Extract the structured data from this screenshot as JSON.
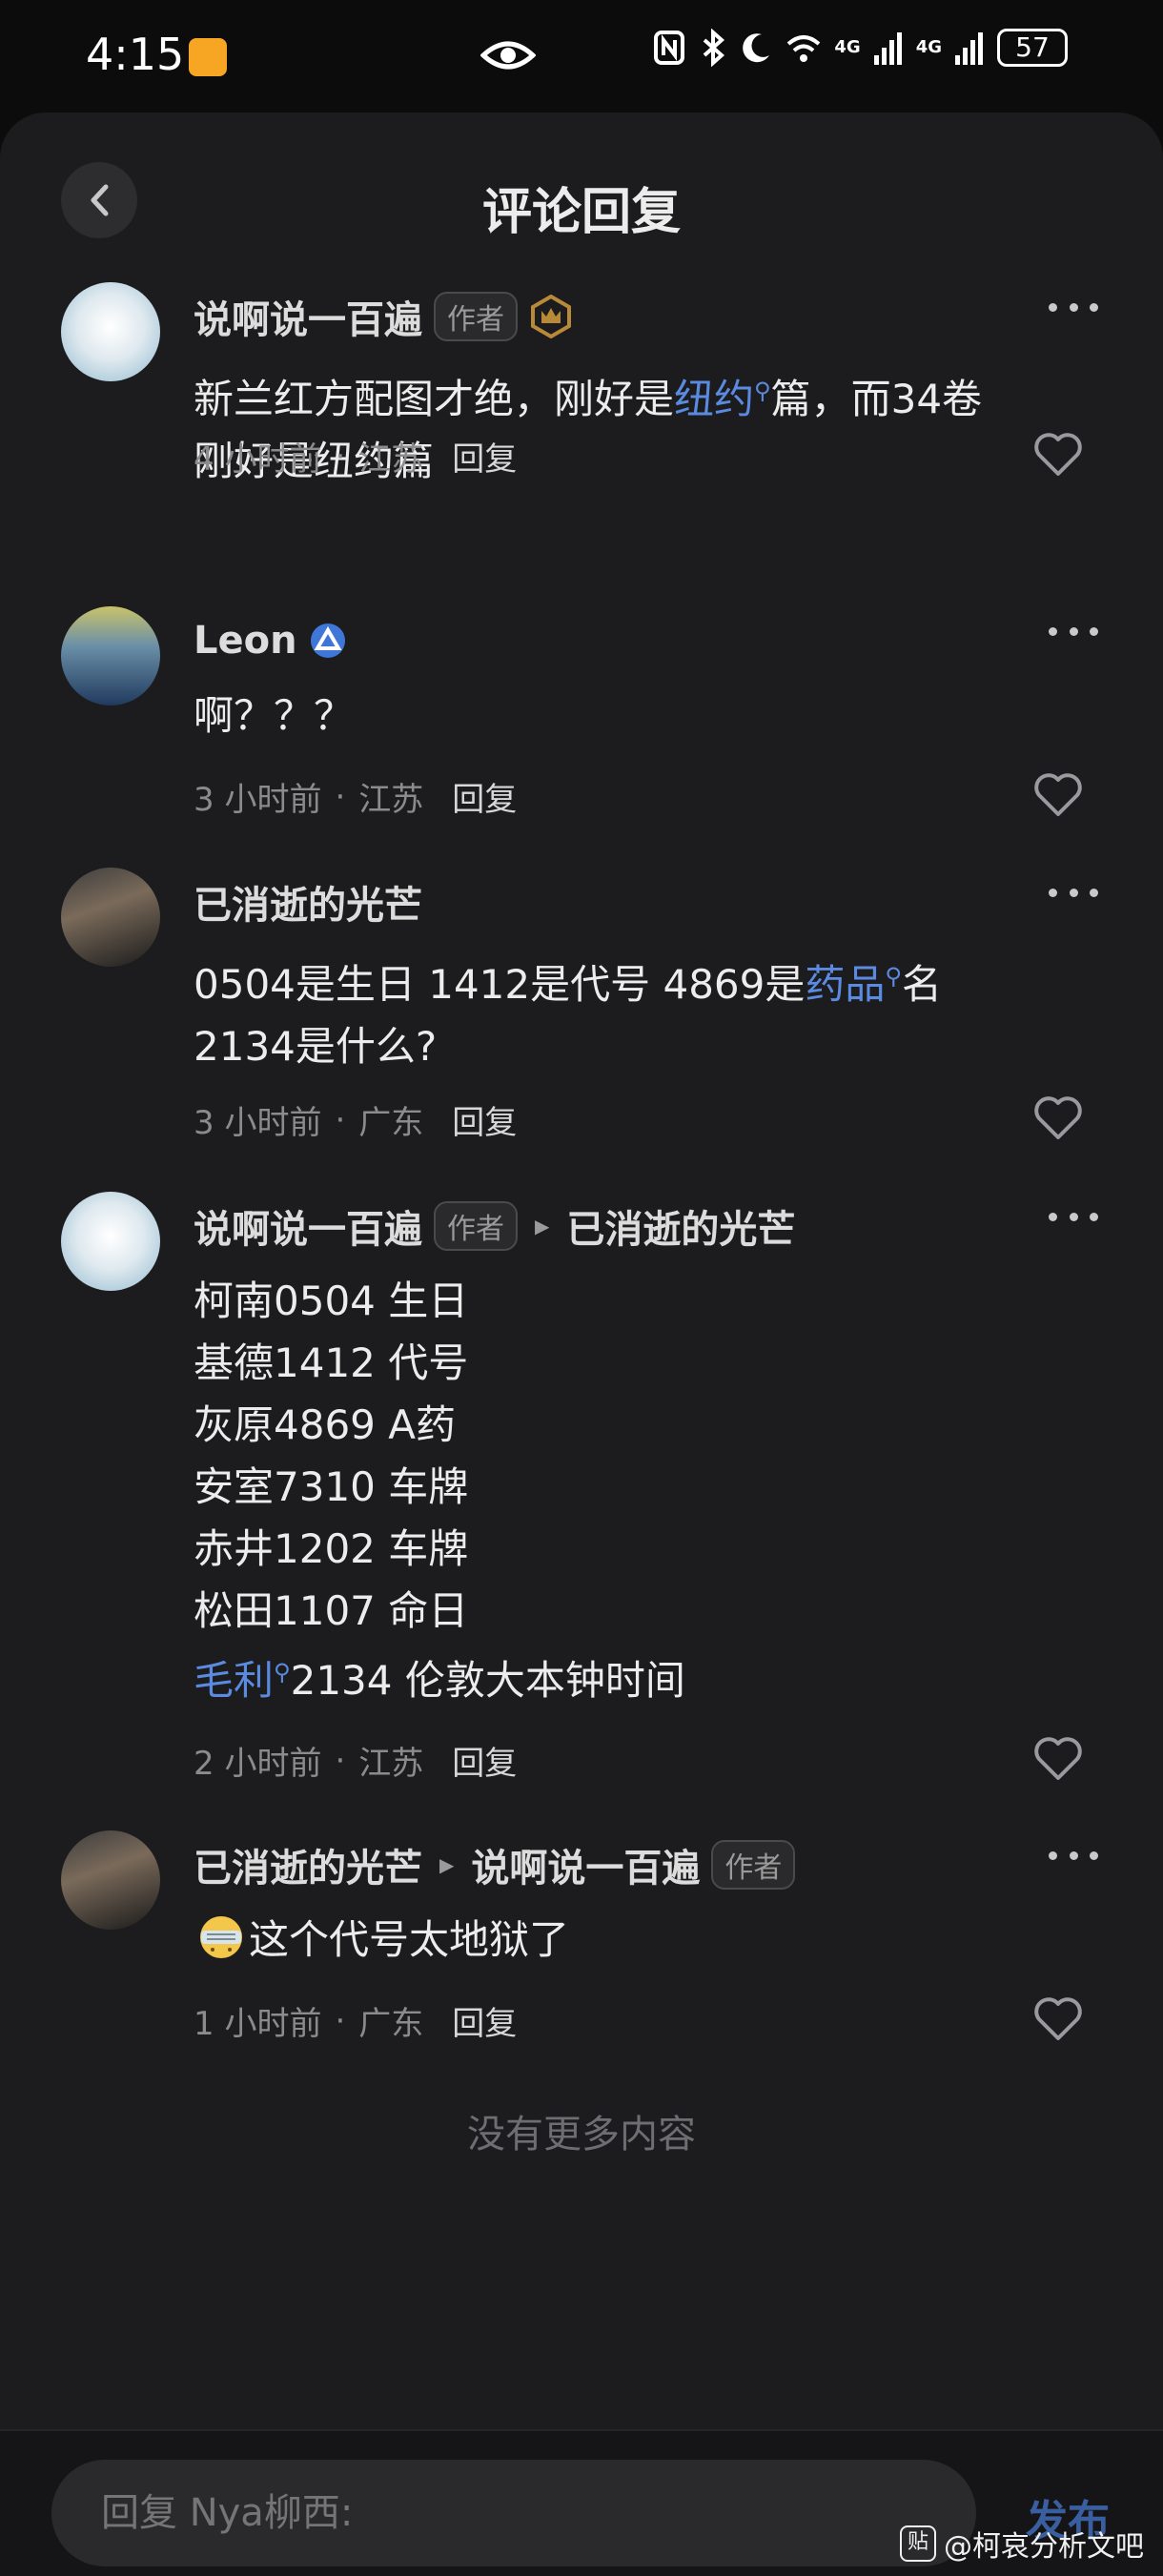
{
  "status_bar": {
    "time": "4:15",
    "battery": "57",
    "net1": "4G",
    "net2": "4G"
  },
  "header": {
    "title": "评论回复"
  },
  "comments": [
    {
      "name": "说啊说一百遍",
      "tag": "作者",
      "body_line1_pre": "新兰红方配图才绝，刚好是",
      "body_line1_link": "纽约",
      "body_line1_post": "篇，而34卷",
      "body_line2": "刚好是纽约篇",
      "time": "4 小时前",
      "location": "江苏",
      "reply": "回复"
    },
    {
      "name": "Leon",
      "body": "啊？？？",
      "time": "3 小时前",
      "location": "江苏",
      "reply": "回复"
    },
    {
      "name": "已消逝的光芒",
      "body_line1_pre": "0504是生日 1412是代号 4869是",
      "body_line1_link": "药品",
      "body_line1_post": "名",
      "body_line2": "2134是什么?",
      "time": "3 小时前",
      "location": "广东",
      "reply": "回复"
    },
    {
      "name": "说啊说一百遍",
      "tag": "作者",
      "reply_to": "已消逝的光芒",
      "lines": [
        "柯南0504 生日",
        "基德1412 代号",
        "灰原4869 A药",
        "安室7310 车牌",
        "赤井1202 车牌",
        "松田1107 命日"
      ],
      "last_line_link": "毛利",
      "last_line_post": "2134 伦敦大本钟时间",
      "time": "2 小时前",
      "location": "江苏",
      "reply": "回复"
    },
    {
      "name": "已消逝的光芒",
      "reply_to": "说啊说一百遍",
      "reply_to_tag": "作者",
      "body": "这个代号太地狱了",
      "time": "1 小时前",
      "location": "广东",
      "reply": "回复"
    }
  ],
  "footer": {
    "no_more": "没有更多内容"
  },
  "input": {
    "placeholder": "回复 Nya柳西:",
    "publish": "发布"
  },
  "watermark": {
    "icon_text": "贴",
    "text": "@柯哀分析文吧"
  },
  "colors": {
    "link": "#5b8be0",
    "background": "#1c1c1e"
  }
}
